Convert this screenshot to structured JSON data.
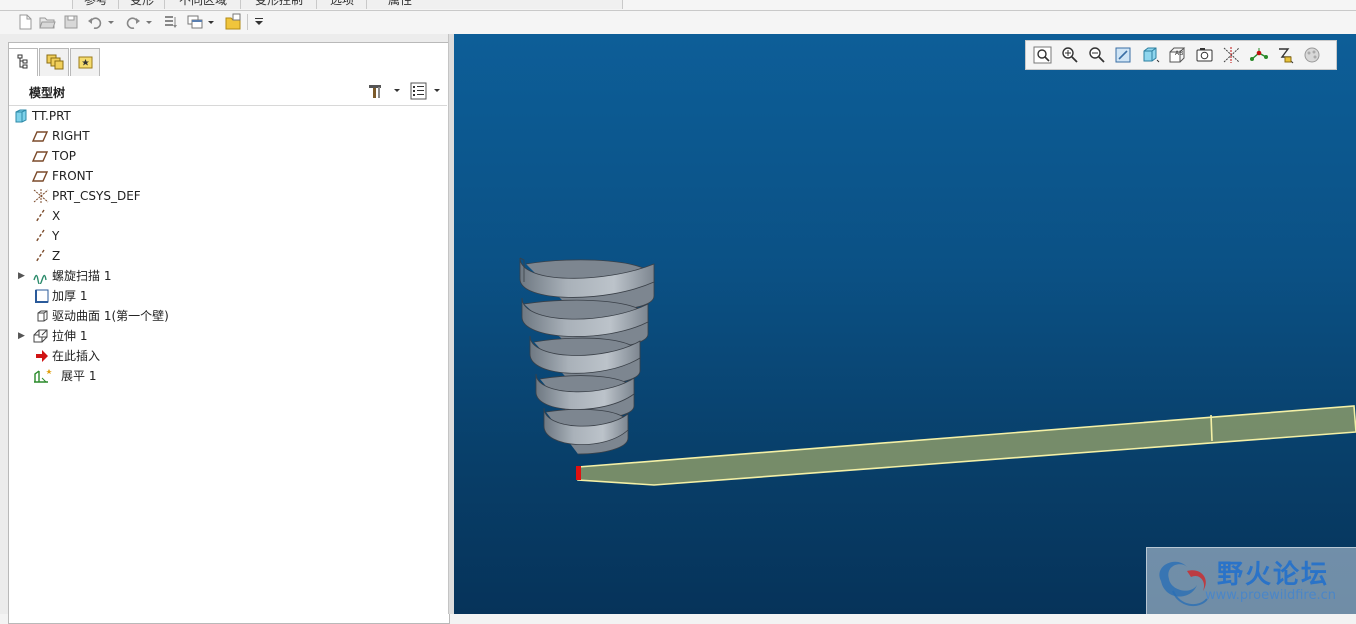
{
  "ribbon": {
    "tabs": [
      "参考",
      "变形",
      "不同区域",
      "变形控制",
      "选项",
      "属性"
    ]
  },
  "quick_access": {
    "icons": [
      "new-icon",
      "open-icon",
      "save-icon",
      "undo-icon",
      "redo-icon",
      "regenerate-icon",
      "windows-icon",
      "close-window-icon",
      "customize-icon"
    ]
  },
  "model_tree": {
    "tabs": [
      "model-tree-tab",
      "layer-tree-tab",
      "favorites-tab"
    ],
    "title": "模型树",
    "items": [
      {
        "label": "TT.PRT",
        "icon": "part-icon",
        "indent": 0,
        "expandable": false
      },
      {
        "label": "RIGHT",
        "icon": "datum-plane-icon",
        "indent": 1,
        "expandable": false
      },
      {
        "label": "TOP",
        "icon": "datum-plane-icon",
        "indent": 1,
        "expandable": false
      },
      {
        "label": "FRONT",
        "icon": "datum-plane-icon",
        "indent": 1,
        "expandable": false
      },
      {
        "label": "PRT_CSYS_DEF",
        "icon": "csys-icon",
        "indent": 1,
        "expandable": false
      },
      {
        "label": "X",
        "icon": "datum-axis-icon",
        "indent": 1,
        "expandable": false
      },
      {
        "label": "Y",
        "icon": "datum-axis-icon",
        "indent": 1,
        "expandable": false
      },
      {
        "label": "Z",
        "icon": "datum-axis-icon",
        "indent": 1,
        "expandable": false
      },
      {
        "label": "螺旋扫描 1",
        "icon": "helical-sweep-icon",
        "indent": 1,
        "expandable": true
      },
      {
        "label": "加厚 1",
        "icon": "thicken-icon",
        "indent": 1,
        "expandable": false
      },
      {
        "label": "驱动曲面 1(第一个壁)",
        "icon": "driving-surface-icon",
        "indent": 1,
        "expandable": false
      },
      {
        "label": "拉伸 1",
        "icon": "extrude-icon",
        "indent": 1,
        "expandable": true
      },
      {
        "label": "在此插入",
        "icon": "insert-here-icon",
        "indent": 1,
        "expandable": false
      },
      {
        "label": "展平 1",
        "icon": "flatten-icon",
        "indent": 1,
        "expandable": false
      }
    ]
  },
  "graphics": {
    "toolbar": [
      "refit-icon",
      "zoom-in-icon",
      "zoom-out-icon",
      "repaint-icon",
      "display-style-icon",
      "saved-orientations-icon",
      "view-manager-icon",
      "datum-display-icon",
      "spin-center-icon",
      "annotation-display-icon",
      "appearance-icon"
    ],
    "colors": {
      "background_top": "#0d5e98",
      "background_bottom": "#06335a",
      "flat_pattern": "#8a9a6a",
      "flat_edge": "#f4f0a6",
      "spiral": "#9aa3ad"
    }
  },
  "watermark": {
    "title": "野火论坛",
    "url": "www.proewildfire.cn"
  }
}
